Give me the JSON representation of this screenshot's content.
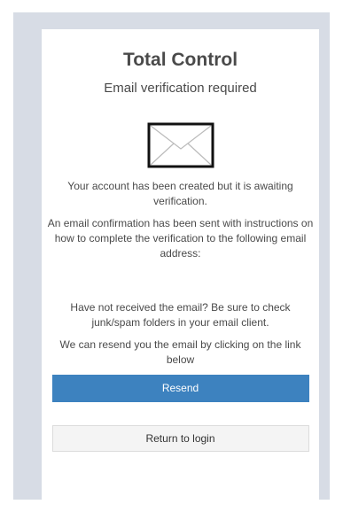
{
  "app": {
    "title": "Total Control",
    "subtitle": "Email verification required"
  },
  "icons": {
    "envelope": "envelope-icon"
  },
  "messages": {
    "account_created": "Your account has been created but it is awaiting verification.",
    "email_sent": "An email confirmation has been sent with instructions on how to complete the verification to the following email address:",
    "email_address": "",
    "not_received": "Have not received the email? Be sure to check junk/spam folders in your email client.",
    "resend_hint": "We can resend you the email by clicking on the link below"
  },
  "buttons": {
    "resend": "Resend",
    "return_to_login": "Return to login"
  },
  "colors": {
    "backdrop": "#d7dce5",
    "primary": "#3d82bf",
    "secondary_bg": "#f4f4f4",
    "text": "#4a4a4a"
  }
}
